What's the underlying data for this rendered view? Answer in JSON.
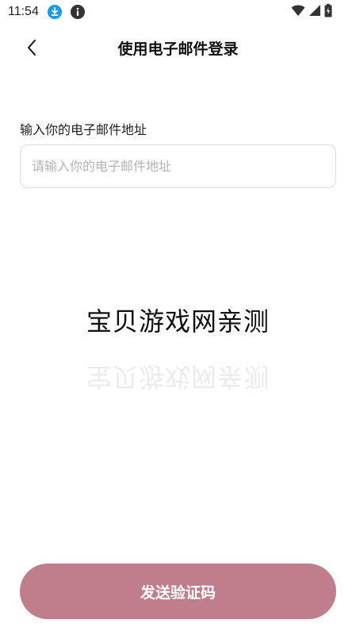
{
  "status_bar": {
    "time": "11:54",
    "icons": [
      "download-icon",
      "info-icon",
      "wifi-icon",
      "signal-icon",
      "battery-icon"
    ]
  },
  "header": {
    "back_icon": "chevron-left-icon",
    "title": "使用电子邮件登录"
  },
  "form": {
    "email_label": "输入你的电子邮件地址",
    "email_placeholder": "请输入你的电子邮件地址",
    "email_value": ""
  },
  "watermark": {
    "text": "宝贝游戏网亲测"
  },
  "actions": {
    "send_code_label": "发送验证码"
  },
  "colors": {
    "primary_button": "#c07e8c",
    "download_badge": "#1a9be8",
    "status_icons": "#333333"
  }
}
